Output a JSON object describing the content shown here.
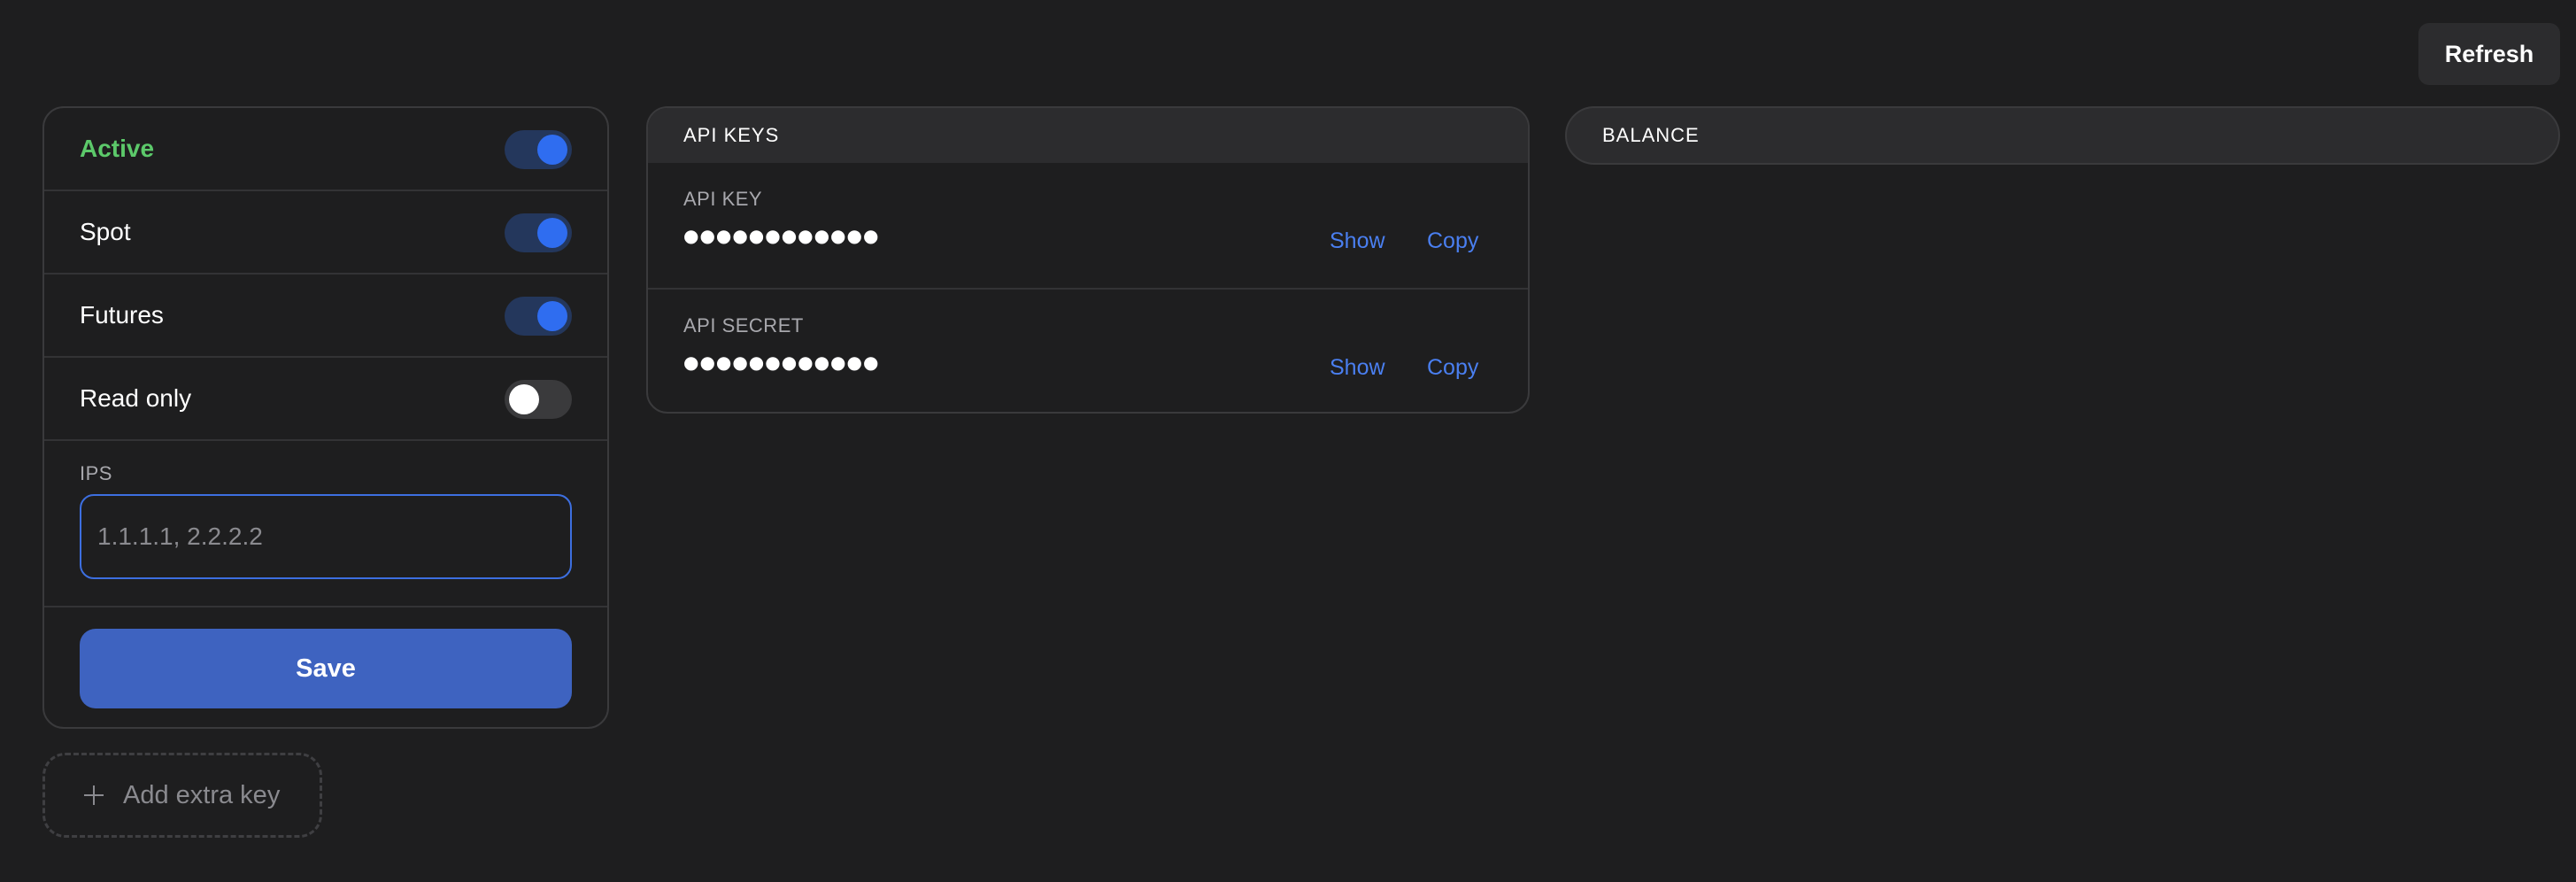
{
  "header": {
    "refresh_label": "Refresh"
  },
  "settings": {
    "toggles": [
      {
        "label": "Active",
        "on": true
      },
      {
        "label": "Spot",
        "on": true
      },
      {
        "label": "Futures",
        "on": true
      },
      {
        "label": "Read only",
        "on": false
      }
    ],
    "ips": {
      "label": "IPS",
      "value": "",
      "placeholder": "1.1.1.1, 2.2.2.2"
    },
    "save_label": "Save"
  },
  "add_key": {
    "label": "Add extra key",
    "icon": "plus-icon"
  },
  "api_keys": {
    "title": "API KEYS",
    "rows": [
      {
        "label": "API KEY",
        "value": "●●●●●●●●●●●●",
        "show_label": "Show",
        "copy_label": "Copy"
      },
      {
        "label": "API SECRET",
        "value": "●●●●●●●●●●●●",
        "show_label": "Show",
        "copy_label": "Copy"
      }
    ]
  },
  "balance": {
    "title": "BALANCE"
  },
  "colors": {
    "background": "#1e1e1f",
    "accent": "#3e63c0",
    "active_green": "#5cc96a",
    "link_blue": "#4a7ff0"
  }
}
